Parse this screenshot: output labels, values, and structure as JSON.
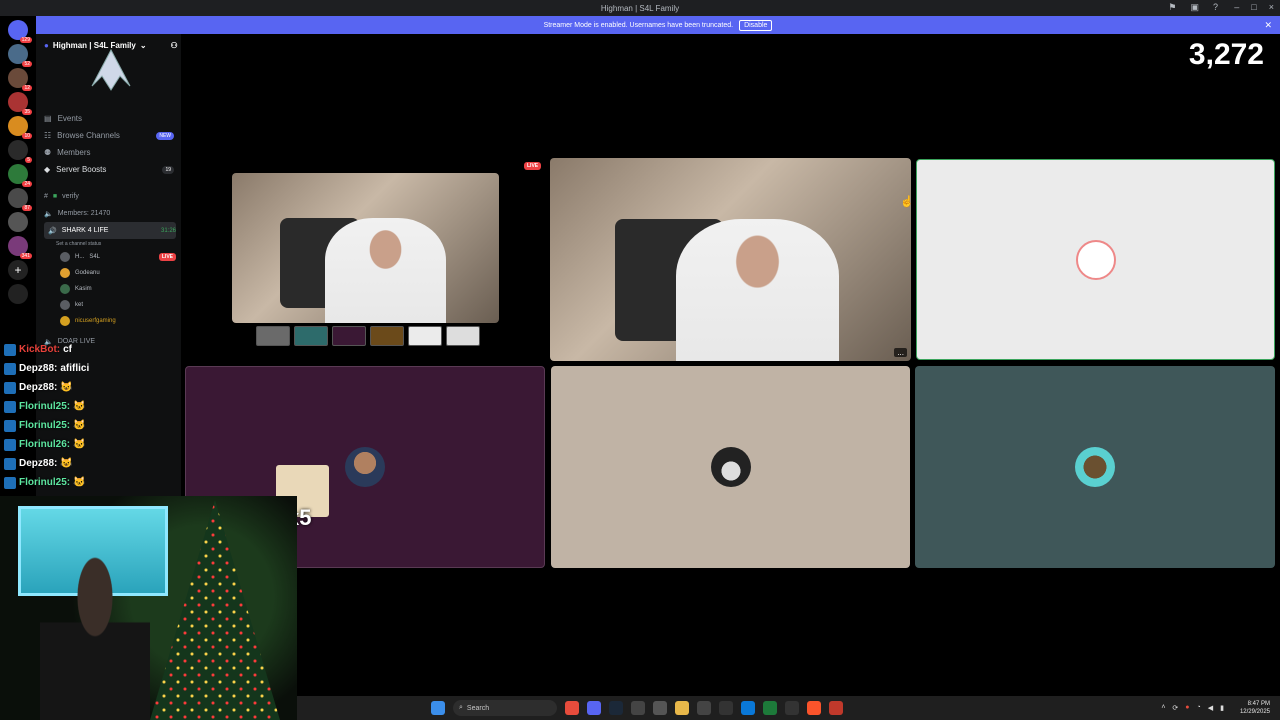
{
  "window": {
    "title": "Highman | S4L Family"
  },
  "banner": {
    "text": "Streamer Mode is enabled. Usernames have been truncated.",
    "disable_label": "Disable"
  },
  "server": {
    "name": "Highman | S4L Family"
  },
  "menu": [
    {
      "label": "Events"
    },
    {
      "label": "Browse Channels",
      "badge": "NEW"
    },
    {
      "label": "Members"
    },
    {
      "label": "Server Boosts",
      "badge": "19"
    }
  ],
  "channels": {
    "verify": "verify",
    "members_count": "Members: 21470",
    "voice_channel": "SHARK 4 LIFE",
    "voice_time": "31:26",
    "channel_status": "Set a channel status",
    "users": [
      {
        "name": "H...",
        "tag": "S4L",
        "live": "LIVE"
      },
      {
        "name": "Godeanu"
      },
      {
        "name": "Kasim"
      },
      {
        "name": "ket"
      },
      {
        "name": "nicuserfgaming"
      }
    ],
    "next_channel": "DOAR LIVE"
  },
  "counter": "3,272",
  "stream": {
    "live_label": "LIVE",
    "more": "...",
    "multiplier": "x5"
  },
  "chat": [
    {
      "user": "KickBot:",
      "text": "cf",
      "color": "#e8413a"
    },
    {
      "user": "Depz88:",
      "text": "afiflici",
      "color": "#ffffff"
    },
    {
      "user": "Depz88:",
      "text": "",
      "color": "#ffffff"
    },
    {
      "user": "Florinul25:",
      "text": "",
      "color": "#5de6a0"
    },
    {
      "user": "Florinul25:",
      "text": "",
      "color": "#5de6a0"
    },
    {
      "user": "Florinul26:",
      "text": "",
      "color": "#5de6a0"
    },
    {
      "user": "Depz88:",
      "text": "",
      "color": "#ffffff"
    },
    {
      "user": "Florinul25:",
      "text": "",
      "color": "#5de6a0"
    }
  ],
  "taskbar": {
    "search_placeholder": "Search",
    "time": "8:47 PM",
    "date": "12/29/2025"
  },
  "colors": {
    "tile_purple": "#3a1834",
    "tile_beige": "#c0b3a5",
    "tile_teal": "#3f5759",
    "tile_light": "#ebebeb",
    "accent": "#5865f2"
  }
}
